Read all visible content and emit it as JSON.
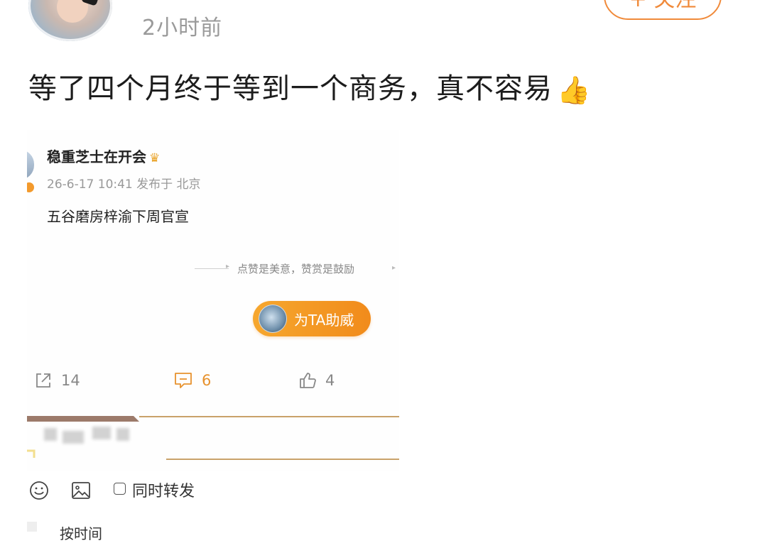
{
  "post": {
    "time": "2小时前",
    "follow_label": "+ 关注",
    "text": "等了四个月终于等到一个商务，真不容易",
    "thumb_icon": "👍"
  },
  "screenshot": {
    "username": "稳重芝士在开会",
    "crown_icon": "♛",
    "meta": "26-6-17 10:41 发布于 北京",
    "content": "五谷磨房梓渝下周官宣",
    "divider_text": "点赞是美意，赞赏是鼓励",
    "cheer_label": "为TA助威",
    "actions": {
      "share_count": "14",
      "comment_count": "6",
      "like_count": "4"
    },
    "colors": {
      "accent": "#f08a3a",
      "cheer": "#f39a25",
      "gold_line": "#c9a26a"
    }
  },
  "toolbar": {
    "repost_label": "同时转发",
    "sort_label": "按时间"
  },
  "icons": [
    "emoji-icon",
    "image-icon",
    "share-icon",
    "comment-icon",
    "like-icon",
    "crown-icon",
    "thumbs-up-icon"
  ]
}
